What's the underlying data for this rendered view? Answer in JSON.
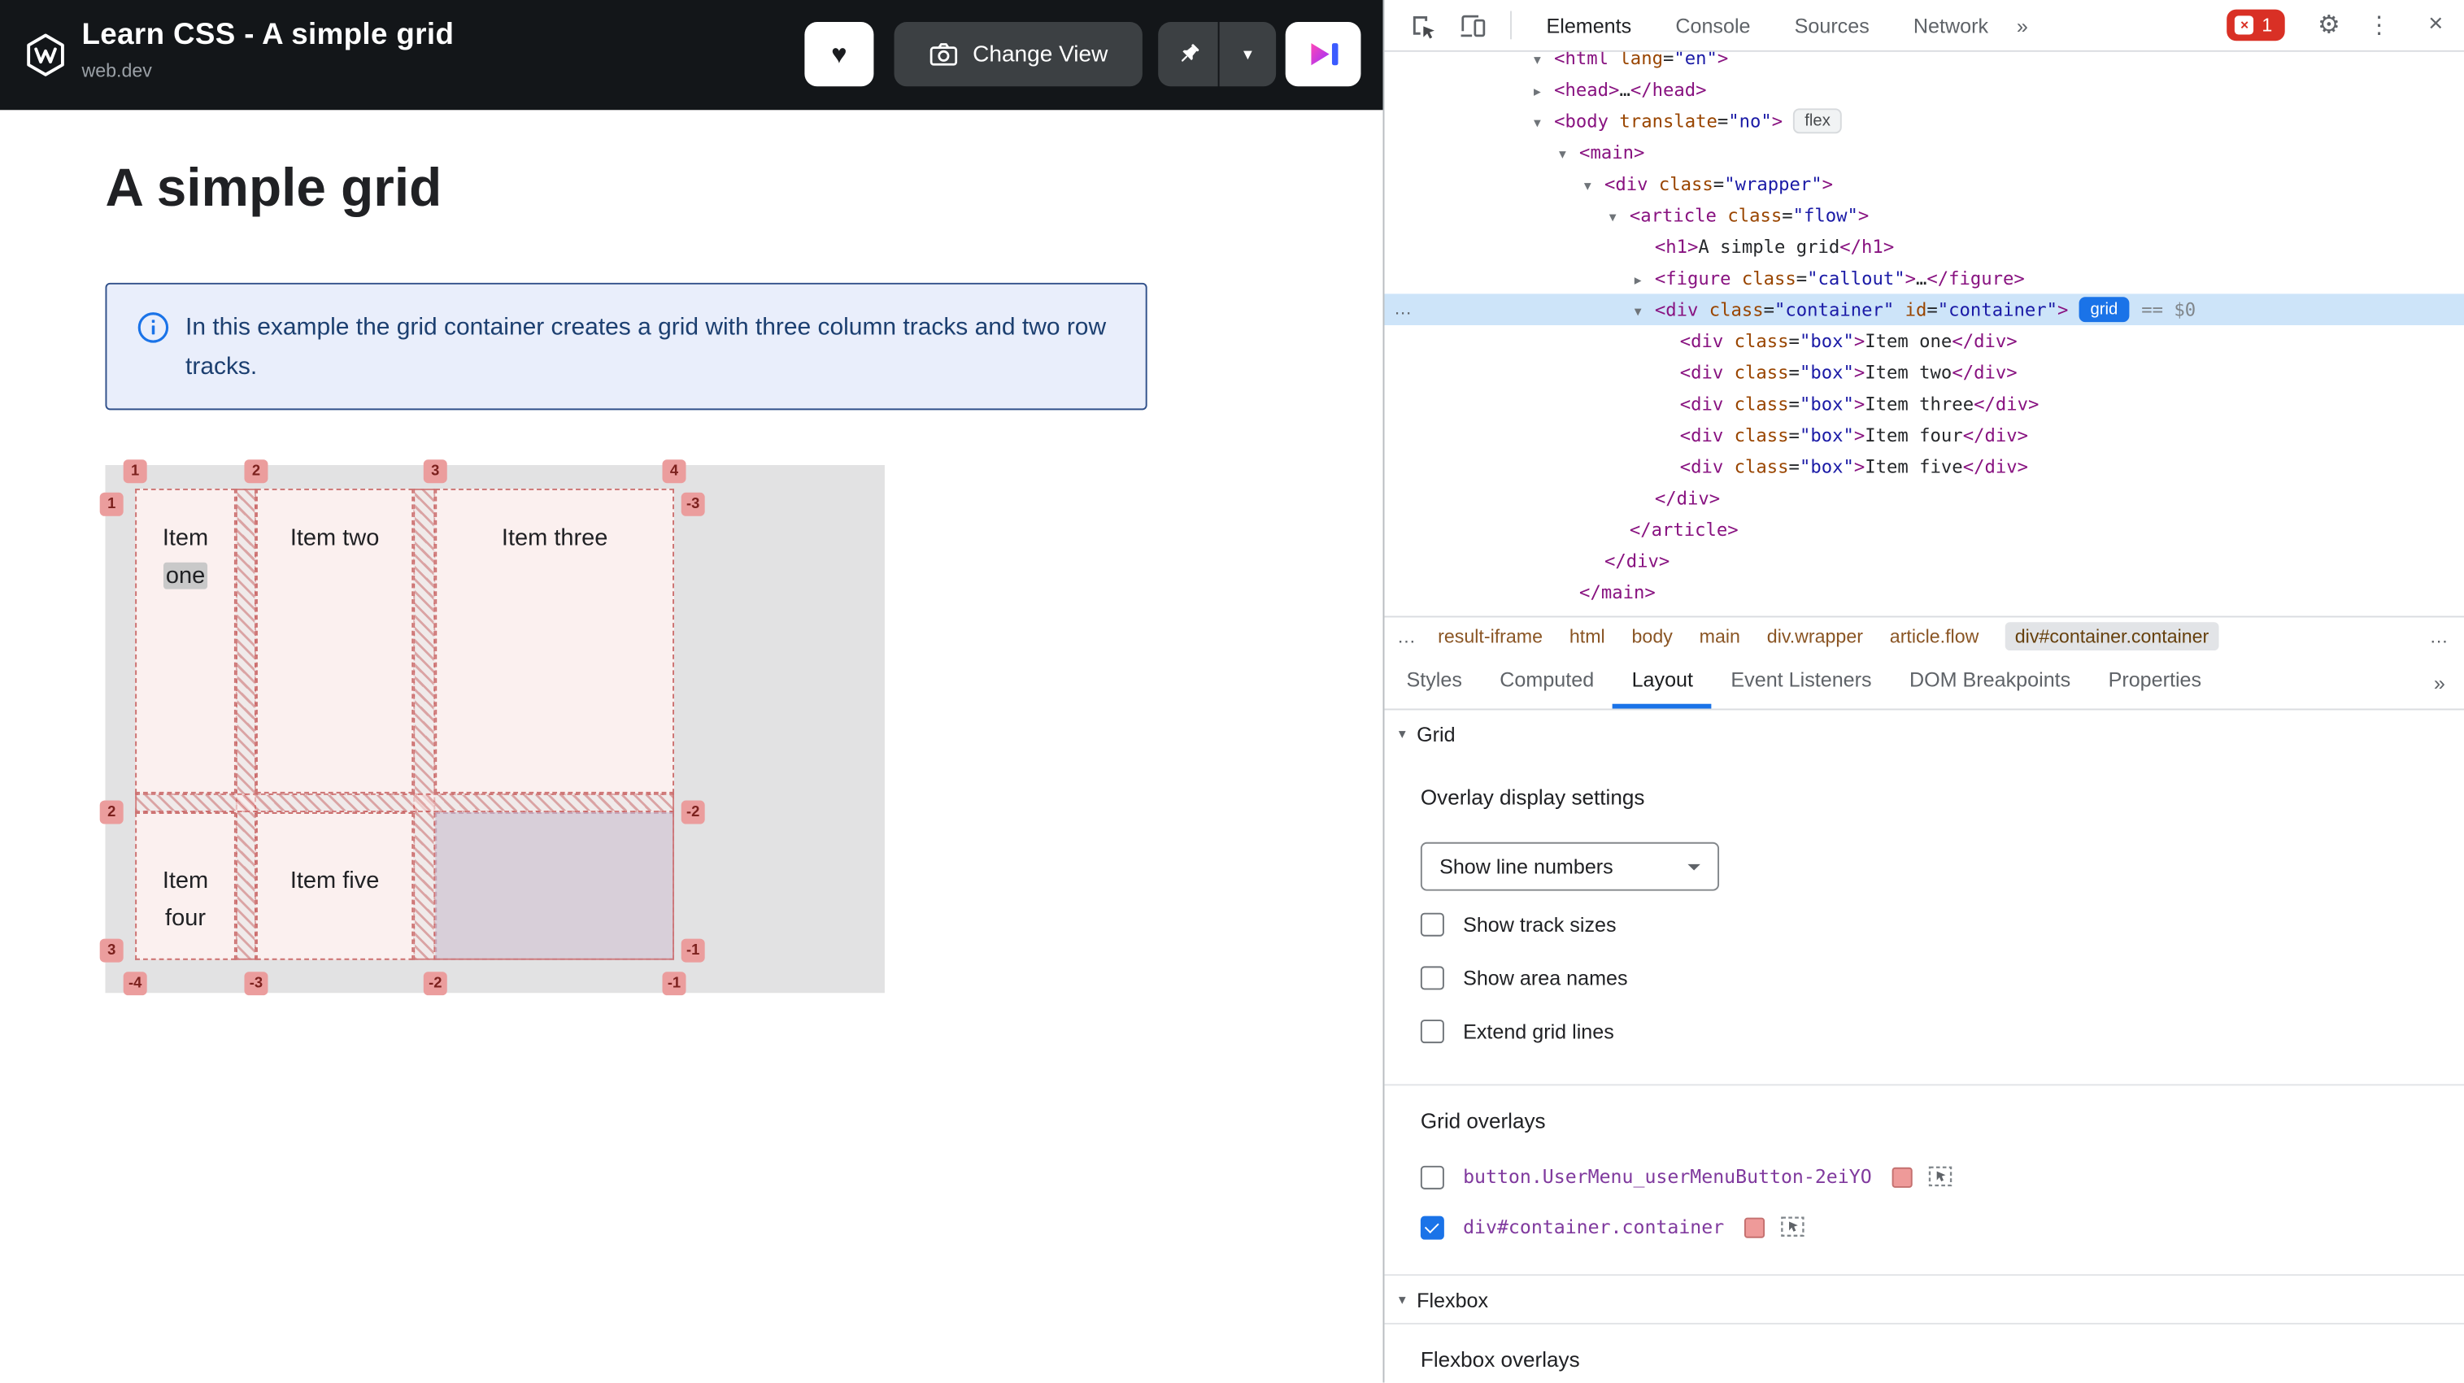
{
  "colors": {
    "accent_blue": "#1a73e8",
    "error_red": "#d93025",
    "header_bg": "#131619",
    "callout_bg": "#e9eefb",
    "callout_border": "#30508a",
    "callout_text": "#1c3f70",
    "demo_bg": "#e2e2e3",
    "grid_overlay_pink": "#eb9d9d",
    "grid_item_bg": "#fbf0ef",
    "tree_selection": "#cde4f9",
    "tag_color": "#881280",
    "attr_color": "#994500",
    "value_color": "#1a1aa6",
    "crumb_color": "#8a5524",
    "overlay_label_color": "#803a9e"
  },
  "icons": {
    "heart": "♥",
    "chevron_down": "▾",
    "triangle_down": "▾",
    "gear": "⚙",
    "kebab": "⋮",
    "close": "×",
    "error_x": "×"
  },
  "page": {
    "header": {
      "title": "Learn CSS - A simple grid",
      "subtitle": "web.dev",
      "change_view_label": "Change View"
    },
    "heading": "A simple grid",
    "callout": {
      "text": "In this example the grid container creates a grid with three column tracks and two row tracks."
    },
    "grid_demo": {
      "items": [
        {
          "text": "Item one",
          "highlight": "one"
        },
        {
          "text": "Item two"
        },
        {
          "text": "Item three"
        },
        {
          "text": "Item four"
        },
        {
          "text": "Item five"
        }
      ],
      "line_numbers": {
        "top": [
          "1",
          "2",
          "3",
          "4"
        ],
        "right": [
          "-3",
          "-2",
          "-1"
        ],
        "left": [
          "1",
          "2",
          "3"
        ],
        "bottom": [
          "-4",
          "-3",
          "-2",
          "-1"
        ]
      }
    }
  },
  "devtools": {
    "tabs": [
      {
        "label": "Elements",
        "active": true
      },
      {
        "label": "Console"
      },
      {
        "label": "Sources"
      },
      {
        "label": "Network"
      }
    ],
    "more_symbol": "»",
    "error_count": "1",
    "tree": [
      {
        "indent": 3,
        "arrow": "open",
        "seg": [
          [
            "tag",
            "<html"
          ],
          [
            "attr",
            " lang"
          ],
          [
            "eq",
            "="
          ],
          [
            "val",
            "\"en\""
          ],
          [
            "tag",
            ">"
          ]
        ]
      },
      {
        "indent": 3,
        "arrow": "closed",
        "seg": [
          [
            "tag",
            "<head"
          ],
          [
            "tag",
            ">"
          ],
          [
            "plain",
            "…"
          ],
          [
            "tag",
            "</head>"
          ]
        ]
      },
      {
        "indent": 3,
        "arrow": "open",
        "seg": [
          [
            "tag",
            "<body"
          ],
          [
            "attr",
            " translate"
          ],
          [
            "eq",
            "="
          ],
          [
            "val",
            "\"no\""
          ],
          [
            "tag",
            ">"
          ]
        ],
        "badges": [
          {
            "style": "gray",
            "label": "flex"
          }
        ]
      },
      {
        "indent": 4,
        "arrow": "open",
        "seg": [
          [
            "tag",
            "<main>"
          ]
        ]
      },
      {
        "indent": 5,
        "arrow": "open",
        "seg": [
          [
            "tag",
            "<div"
          ],
          [
            "attr",
            " class"
          ],
          [
            "eq",
            "="
          ],
          [
            "val",
            "\"wrapper\""
          ],
          [
            "tag",
            ">"
          ]
        ]
      },
      {
        "indent": 6,
        "arrow": "open",
        "seg": [
          [
            "tag",
            "<article"
          ],
          [
            "attr",
            " class"
          ],
          [
            "eq",
            "="
          ],
          [
            "val",
            "\"flow\""
          ],
          [
            "tag",
            ">"
          ]
        ]
      },
      {
        "indent": 7,
        "arrow": "none",
        "seg": [
          [
            "tag",
            "<h1>"
          ],
          [
            "plain",
            "A simple grid"
          ],
          [
            "tag",
            "</h1>"
          ]
        ]
      },
      {
        "indent": 7,
        "arrow": "closed",
        "seg": [
          [
            "tag",
            "<figure"
          ],
          [
            "attr",
            " class"
          ],
          [
            "eq",
            "="
          ],
          [
            "val",
            "\"callout\""
          ],
          [
            "tag",
            ">"
          ],
          [
            "plain",
            "…"
          ],
          [
            "tag",
            "</figure>"
          ]
        ]
      },
      {
        "indent": 7,
        "arrow": "open",
        "selected": true,
        "gutter": "…",
        "seg": [
          [
            "tag",
            "<div"
          ],
          [
            "attr",
            " class"
          ],
          [
            "eq",
            "="
          ],
          [
            "val",
            "\"container\""
          ],
          [
            "attr",
            " id"
          ],
          [
            "eq",
            "="
          ],
          [
            "val",
            "\"container\""
          ],
          [
            "tag",
            ">"
          ]
        ],
        "badges": [
          {
            "style": "blue",
            "label": "grid"
          }
        ],
        "suffix": "== $0"
      },
      {
        "indent": 8,
        "arrow": "none",
        "seg": [
          [
            "tag",
            "<div"
          ],
          [
            "attr",
            " class"
          ],
          [
            "eq",
            "="
          ],
          [
            "val",
            "\"box\""
          ],
          [
            "tag",
            ">"
          ],
          [
            "plain",
            "Item one"
          ],
          [
            "tag",
            "</div>"
          ]
        ]
      },
      {
        "indent": 8,
        "arrow": "none",
        "seg": [
          [
            "tag",
            "<div"
          ],
          [
            "attr",
            " class"
          ],
          [
            "eq",
            "="
          ],
          [
            "val",
            "\"box\""
          ],
          [
            "tag",
            ">"
          ],
          [
            "plain",
            "Item two"
          ],
          [
            "tag",
            "</div>"
          ]
        ]
      },
      {
        "indent": 8,
        "arrow": "none",
        "seg": [
          [
            "tag",
            "<div"
          ],
          [
            "attr",
            " class"
          ],
          [
            "eq",
            "="
          ],
          [
            "val",
            "\"box\""
          ],
          [
            "tag",
            ">"
          ],
          [
            "plain",
            "Item three"
          ],
          [
            "tag",
            "</div>"
          ]
        ]
      },
      {
        "indent": 8,
        "arrow": "none",
        "seg": [
          [
            "tag",
            "<div"
          ],
          [
            "attr",
            " class"
          ],
          [
            "eq",
            "="
          ],
          [
            "val",
            "\"box\""
          ],
          [
            "tag",
            ">"
          ],
          [
            "plain",
            "Item four"
          ],
          [
            "tag",
            "</div>"
          ]
        ]
      },
      {
        "indent": 8,
        "arrow": "none",
        "seg": [
          [
            "tag",
            "<div"
          ],
          [
            "attr",
            " class"
          ],
          [
            "eq",
            "="
          ],
          [
            "val",
            "\"box\""
          ],
          [
            "tag",
            ">"
          ],
          [
            "plain",
            "Item five"
          ],
          [
            "tag",
            "</div>"
          ]
        ]
      },
      {
        "indent": 7,
        "arrow": "none",
        "seg": [
          [
            "tag",
            "</div>"
          ]
        ]
      },
      {
        "indent": 6,
        "arrow": "none",
        "seg": [
          [
            "tag",
            "</article>"
          ]
        ]
      },
      {
        "indent": 5,
        "arrow": "none",
        "seg": [
          [
            "tag",
            "</div>"
          ]
        ]
      },
      {
        "indent": 4,
        "arrow": "none",
        "seg": [
          [
            "tag",
            "</main>"
          ]
        ]
      }
    ],
    "breadcrumb_overflow": "…",
    "breadcrumbs": [
      {
        "label": "result-iframe"
      },
      {
        "label": "html"
      },
      {
        "label": "body"
      },
      {
        "label": "main"
      },
      {
        "label": "div.wrapper"
      },
      {
        "label": "article.flow"
      },
      {
        "label": "div#container.container",
        "selected": true
      }
    ],
    "sidebar_tabs": [
      {
        "label": "Styles"
      },
      {
        "label": "Computed"
      },
      {
        "label": "Layout",
        "active": true
      },
      {
        "label": "Event Listeners"
      },
      {
        "label": "DOM Breakpoints"
      },
      {
        "label": "Properties"
      }
    ],
    "layout_pane": {
      "grid_section": "Grid",
      "overlay_settings_title": "Overlay display settings",
      "dropdown_value": "Show line numbers",
      "checkboxes": [
        {
          "label": "Show track sizes",
          "checked": false
        },
        {
          "label": "Show area names",
          "checked": false
        },
        {
          "label": "Extend grid lines",
          "checked": false
        }
      ],
      "grid_overlays_title": "Grid overlays",
      "grid_overlays": [
        {
          "label": "button.UserMenu_userMenuButton-2eiYO",
          "checked": false
        },
        {
          "label": "div#container.container",
          "checked": true
        }
      ],
      "flexbox_section": "Flexbox",
      "flexbox_overlays_title": "Flexbox overlays"
    }
  }
}
